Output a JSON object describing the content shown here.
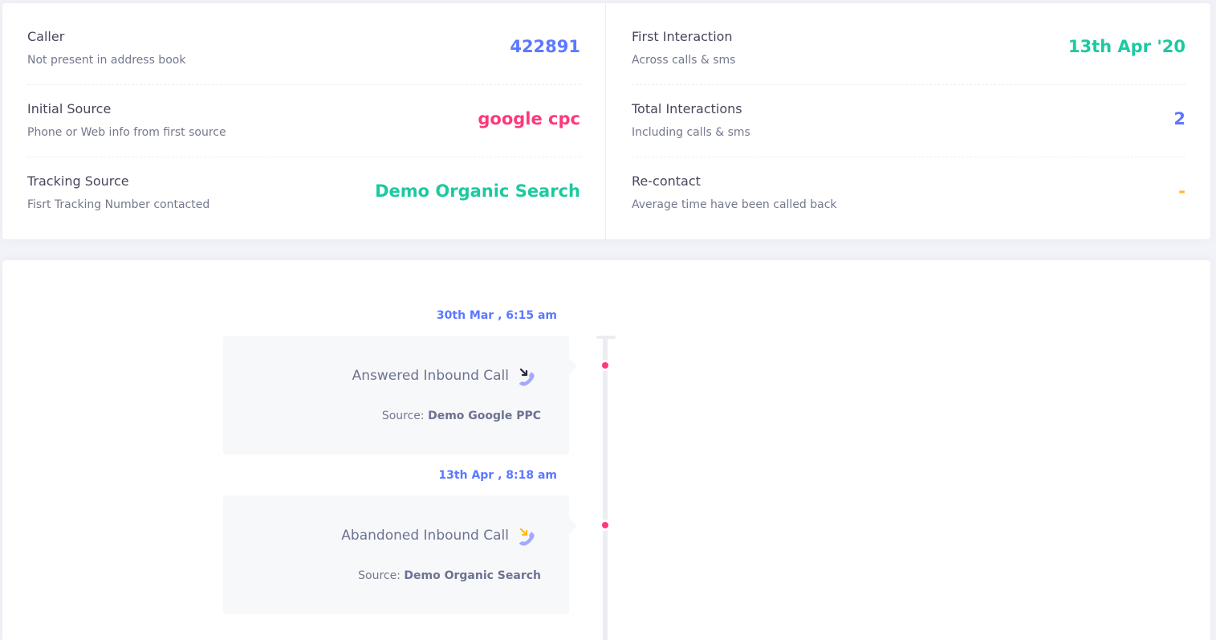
{
  "stats": {
    "left": [
      {
        "title": "Caller",
        "desc": "Not present in address book",
        "value": "422891",
        "color": "#5d78ff"
      },
      {
        "title": "Initial Source",
        "desc": "Phone or Web info from first source",
        "value": "google cpc",
        "color": "#fd397a"
      },
      {
        "title": "Tracking Source",
        "desc": "Fisrt Tracking Number contacted",
        "value": "Demo Organic Search",
        "color": "#1dc9a0"
      }
    ],
    "right": [
      {
        "title": "First Interaction",
        "desc": "Across calls & sms",
        "value": "13th Apr '20",
        "color": "#1dc9a0"
      },
      {
        "title": "Total Interactions",
        "desc": "Including calls & sms",
        "value": "2",
        "color": "#5d78ff"
      },
      {
        "title": "Re-contact",
        "desc": "Average time have been called back",
        "value": "-",
        "color": "#ffb822"
      }
    ]
  },
  "timeline": [
    {
      "date": "30th Mar , 6:15 am",
      "event": "Answered Inbound Call",
      "source_label": "Source:",
      "source": "Demo Google PPC",
      "icon": "answered-call-icon",
      "arrow_color": "#282a3c"
    },
    {
      "date": "13th Apr , 8:18 am",
      "event": "Abandoned Inbound Call",
      "source_label": "Source:",
      "source": "Demo Organic Search",
      "icon": "abandoned-call-icon",
      "arrow_color": "#ffb822"
    }
  ],
  "colors": {
    "accent": "#5d78ff",
    "danger": "#fd397a",
    "success": "#1dc9a0",
    "warning": "#ffb822",
    "phone_icon": "#a3a8ff"
  }
}
